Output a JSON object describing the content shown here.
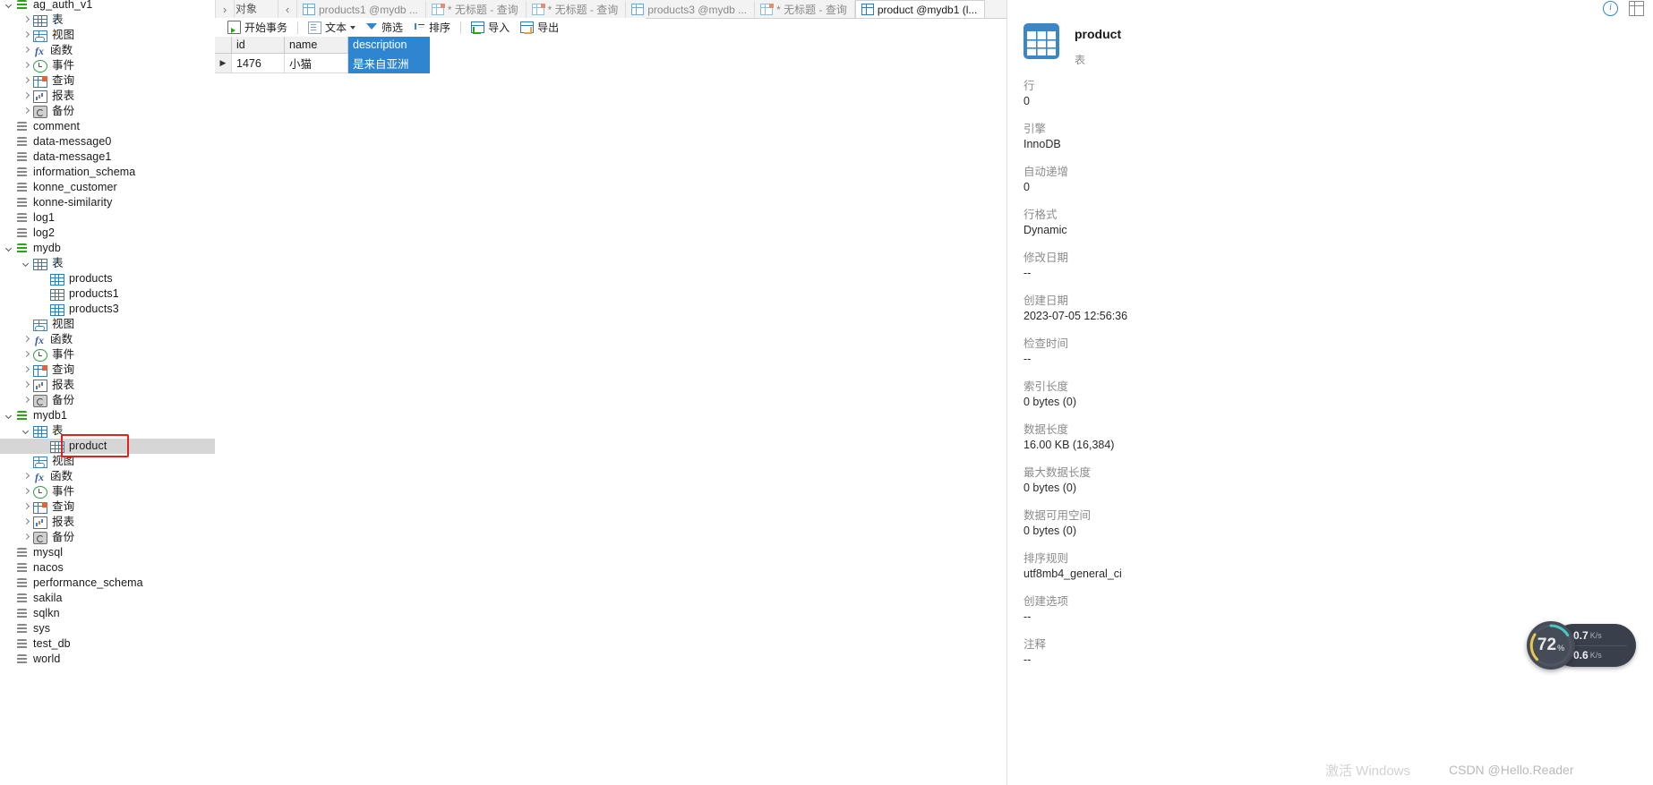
{
  "sidebar": {
    "items": [
      {
        "label": "ag_auth_v1",
        "icon": "database-icon",
        "indent": 0,
        "arrow": "open",
        "iconClass": "ico-db green"
      },
      {
        "label": "表",
        "icon": "table-folder-icon",
        "indent": 1,
        "arrow": "closed",
        "iconClass": "ico-table"
      },
      {
        "label": "视图",
        "icon": "view-icon",
        "indent": 1,
        "arrow": "closed",
        "iconClass": "ico-view"
      },
      {
        "label": "函数",
        "icon": "function-icon",
        "indent": 1,
        "arrow": "closed",
        "iconClass": "ico-fx",
        "glyph": "fx"
      },
      {
        "label": "事件",
        "icon": "event-clock-icon",
        "indent": 1,
        "arrow": "closed",
        "iconClass": "ico-clock"
      },
      {
        "label": "查询",
        "icon": "query-icon",
        "indent": 1,
        "arrow": "closed",
        "iconClass": "ico-query"
      },
      {
        "label": "报表",
        "icon": "report-icon",
        "indent": 1,
        "arrow": "closed",
        "iconClass": "ico-report"
      },
      {
        "label": "备份",
        "icon": "backup-icon",
        "indent": 1,
        "arrow": "closed",
        "iconClass": "ico-backup"
      },
      {
        "label": "comment",
        "icon": "database-icon",
        "indent": 0,
        "arrow": "none",
        "iconClass": "ico-db"
      },
      {
        "label": "data-message0",
        "icon": "database-icon",
        "indent": 0,
        "arrow": "none",
        "iconClass": "ico-db"
      },
      {
        "label": "data-message1",
        "icon": "database-icon",
        "indent": 0,
        "arrow": "none",
        "iconClass": "ico-db"
      },
      {
        "label": "information_schema",
        "icon": "database-icon",
        "indent": 0,
        "arrow": "none",
        "iconClass": "ico-db"
      },
      {
        "label": "konne_customer",
        "icon": "database-icon",
        "indent": 0,
        "arrow": "none",
        "iconClass": "ico-db"
      },
      {
        "label": "konne-similarity",
        "icon": "database-icon",
        "indent": 0,
        "arrow": "none",
        "iconClass": "ico-db"
      },
      {
        "label": "log1",
        "icon": "database-icon",
        "indent": 0,
        "arrow": "none",
        "iconClass": "ico-db"
      },
      {
        "label": "log2",
        "icon": "database-icon",
        "indent": 0,
        "arrow": "none",
        "iconClass": "ico-db"
      },
      {
        "label": "mydb",
        "icon": "database-icon",
        "indent": 0,
        "arrow": "open",
        "iconClass": "ico-db green"
      },
      {
        "label": "表",
        "icon": "table-folder-icon",
        "indent": 1,
        "arrow": "open",
        "iconClass": "ico-table"
      },
      {
        "label": "products",
        "icon": "table-icon",
        "indent": 2,
        "arrow": "none",
        "iconClass": "ico-table"
      },
      {
        "label": "products1",
        "icon": "table-icon",
        "indent": 2,
        "arrow": "none",
        "iconClass": "ico-table"
      },
      {
        "label": "products3",
        "icon": "table-icon",
        "indent": 2,
        "arrow": "none",
        "iconClass": "ico-table"
      },
      {
        "label": "视图",
        "icon": "view-icon",
        "indent": 1,
        "arrow": "none",
        "iconClass": "ico-view"
      },
      {
        "label": "函数",
        "icon": "function-icon",
        "indent": 1,
        "arrow": "closed",
        "iconClass": "ico-fx",
        "glyph": "fx"
      },
      {
        "label": "事件",
        "icon": "event-clock-icon",
        "indent": 1,
        "arrow": "closed",
        "iconClass": "ico-clock"
      },
      {
        "label": "查询",
        "icon": "query-icon",
        "indent": 1,
        "arrow": "closed",
        "iconClass": "ico-query"
      },
      {
        "label": "报表",
        "icon": "report-icon",
        "indent": 1,
        "arrow": "closed",
        "iconClass": "ico-report"
      },
      {
        "label": "备份",
        "icon": "backup-icon",
        "indent": 1,
        "arrow": "closed",
        "iconClass": "ico-backup"
      },
      {
        "label": "mydb1",
        "icon": "database-icon",
        "indent": 0,
        "arrow": "open",
        "iconClass": "ico-db green"
      },
      {
        "label": "表",
        "icon": "table-folder-icon",
        "indent": 1,
        "arrow": "open",
        "iconClass": "ico-table"
      },
      {
        "label": "product",
        "icon": "table-icon",
        "indent": 2,
        "arrow": "none",
        "iconClass": "ico-table",
        "selected": true,
        "highlighted": true
      },
      {
        "label": "视图",
        "icon": "view-icon",
        "indent": 1,
        "arrow": "none",
        "iconClass": "ico-view"
      },
      {
        "label": "函数",
        "icon": "function-icon",
        "indent": 1,
        "arrow": "closed",
        "iconClass": "ico-fx",
        "glyph": "fx"
      },
      {
        "label": "事件",
        "icon": "event-clock-icon",
        "indent": 1,
        "arrow": "closed",
        "iconClass": "ico-clock"
      },
      {
        "label": "查询",
        "icon": "query-icon",
        "indent": 1,
        "arrow": "closed",
        "iconClass": "ico-query"
      },
      {
        "label": "报表",
        "icon": "report-icon",
        "indent": 1,
        "arrow": "closed",
        "iconClass": "ico-report"
      },
      {
        "label": "备份",
        "icon": "backup-icon",
        "indent": 1,
        "arrow": "closed",
        "iconClass": "ico-backup"
      },
      {
        "label": "mysql",
        "icon": "database-icon",
        "indent": 0,
        "arrow": "none",
        "iconClass": "ico-db"
      },
      {
        "label": "nacos",
        "icon": "database-icon",
        "indent": 0,
        "arrow": "none",
        "iconClass": "ico-db"
      },
      {
        "label": "performance_schema",
        "icon": "database-icon",
        "indent": 0,
        "arrow": "none",
        "iconClass": "ico-db"
      },
      {
        "label": "sakila",
        "icon": "database-icon",
        "indent": 0,
        "arrow": "none",
        "iconClass": "ico-db"
      },
      {
        "label": "sqlkn",
        "icon": "database-icon",
        "indent": 0,
        "arrow": "none",
        "iconClass": "ico-db"
      },
      {
        "label": "sys",
        "icon": "database-icon",
        "indent": 0,
        "arrow": "none",
        "iconClass": "ico-db"
      },
      {
        "label": "test_db",
        "icon": "database-icon",
        "indent": 0,
        "arrow": "none",
        "iconClass": "ico-db"
      },
      {
        "label": "world",
        "icon": "database-icon",
        "indent": 0,
        "arrow": "none",
        "iconClass": "ico-db"
      }
    ]
  },
  "topbar": {
    "object_label": "对象",
    "scroll_left": "‹",
    "scroll_right": "›",
    "tabs": [
      {
        "label": "products1 @mydb ...",
        "icon": "grid",
        "active": false
      },
      {
        "label": "* 无标题 - 查询",
        "icon": "qry",
        "active": false
      },
      {
        "label": "* 无标题 - 查询",
        "icon": "qry",
        "active": false
      },
      {
        "label": "products3 @mydb ...",
        "icon": "grid",
        "active": false
      },
      {
        "label": "* 无标题 - 查询",
        "icon": "qry",
        "active": false
      },
      {
        "label": "product @mydb1 (l...",
        "icon": "grid",
        "active": true
      }
    ]
  },
  "toolbar": {
    "begin_transaction": "开始事务",
    "text": "文本",
    "filter": "筛选",
    "sort": "排序",
    "import": "导入",
    "export": "导出"
  },
  "grid": {
    "columns": [
      "id",
      "name",
      "description"
    ],
    "selected_column": "description",
    "rows": [
      {
        "marker": "▶",
        "id": "1476",
        "name": "小猫",
        "description": "是来自亚洲",
        "selected_cell": "description"
      }
    ]
  },
  "info_panel": {
    "name": "product",
    "type": "表",
    "properties": [
      {
        "key": "行",
        "value": "0"
      },
      {
        "key": "引擎",
        "value": "InnoDB"
      },
      {
        "key": "自动递增",
        "value": "0"
      },
      {
        "key": "行格式",
        "value": "Dynamic"
      },
      {
        "key": "修改日期",
        "value": "--"
      },
      {
        "key": "创建日期",
        "value": "2023-07-05 12:56:36"
      },
      {
        "key": "检查时间",
        "value": "--"
      },
      {
        "key": "索引长度",
        "value": "0 bytes (0)"
      },
      {
        "key": "数据长度",
        "value": "16.00 KB (16,384)"
      },
      {
        "key": "最大数据长度",
        "value": "0 bytes (0)"
      },
      {
        "key": "数据可用空间",
        "value": "0 bytes (0)"
      },
      {
        "key": "排序规则",
        "value": "utf8mb4_general_ci"
      },
      {
        "key": "创建选项",
        "value": "--"
      },
      {
        "key": "注释",
        "value": "--"
      }
    ]
  },
  "net_widget": {
    "percent": "72",
    "percent_suffix": "%",
    "upload": "0.7",
    "upload_unit": "K/s",
    "download": "0.6",
    "download_unit": "K/s",
    "up_arrow": "▲",
    "down_arrow": "▼"
  },
  "watermarks": {
    "activate_windows": "激活 Windows",
    "csdn": "CSDN @Hello.Reader"
  },
  "colors": {
    "accent": "#2f86d0",
    "db_green": "#2aa515",
    "highlight_red": "#e81f1f",
    "selection_gray": "#d6d6d6"
  }
}
